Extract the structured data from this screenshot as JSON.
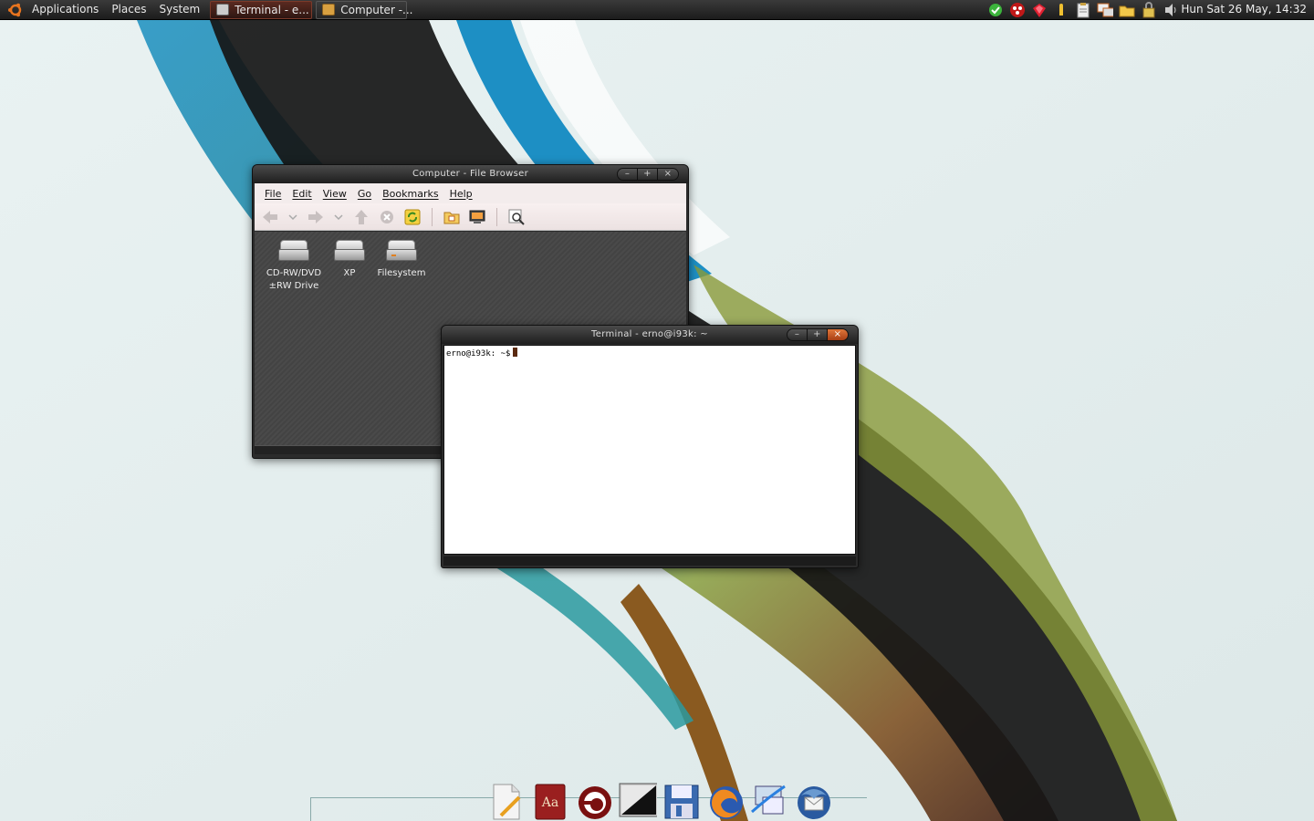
{
  "top_panel": {
    "menus": [
      "Applications",
      "Places",
      "System"
    ],
    "tasks": [
      {
        "label": "Terminal - e...",
        "active": true
      },
      {
        "label": "Computer -...",
        "active": false
      }
    ],
    "tray_icons": [
      "messenger-icon",
      "network-monitor-icon",
      "ruby-icon",
      "power-icon",
      "clipboard-icon",
      "display-icon",
      "folder-icon",
      "lock-icon",
      "volume-icon"
    ],
    "clock": "Hun  Sat 26 May, 14:32"
  },
  "file_browser": {
    "title": "Computer - File Browser",
    "menu": [
      "File",
      "Edit",
      "View",
      "Go",
      "Bookmarks",
      "Help"
    ],
    "drives": [
      {
        "label": "CD-RW/DVD ±RW Drive"
      },
      {
        "label": "XP"
      },
      {
        "label": "Filesystem"
      }
    ]
  },
  "terminal": {
    "title": "Terminal - erno@i93k: ~",
    "prompt": "erno@i93k: ~$"
  },
  "window_buttons": {
    "minimize": "–",
    "maximize": "+",
    "close": "×"
  },
  "dock": {
    "items": [
      "text-editor-icon",
      "dictionary-icon",
      "terminal-swirl-icon",
      "terminal-icon",
      "save-icon",
      "firefox-icon",
      "network-icon",
      "thunderbird-icon"
    ]
  },
  "colors": {
    "panel": "#222222",
    "accent": "#a83f14",
    "terminal_bg": "#ffffff"
  }
}
